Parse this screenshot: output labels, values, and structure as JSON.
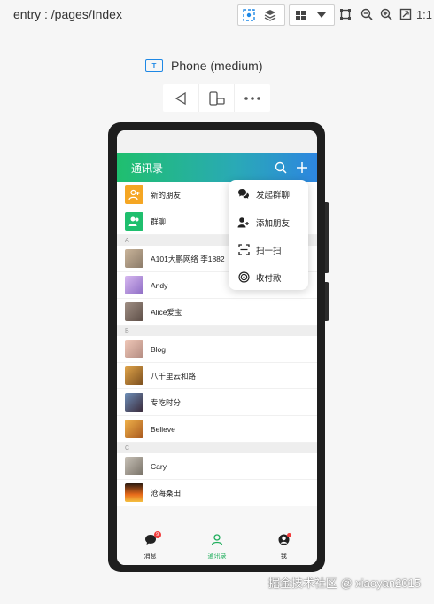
{
  "toolbar": {
    "entry": "entry : /pages/Index",
    "scale_label": "1:1",
    "icons": [
      "inspect-icon",
      "layers-icon",
      "grid-icon",
      "dropdown-icon",
      "crop-icon",
      "zoom-out-icon",
      "zoom-in-icon",
      "fit-icon"
    ]
  },
  "device": {
    "name": "Phone (medium)",
    "actions": [
      "back-icon",
      "rotate-icon",
      "more-icon"
    ]
  },
  "app": {
    "title": "通讯录",
    "accent": "#1fbf6e",
    "contacts_top": [
      {
        "label": "新的朋友",
        "color": "#f5a623"
      },
      {
        "label": "群聊",
        "color": "#1fbf6e"
      }
    ],
    "sections": [
      {
        "letter": "A",
        "items": [
          "A101大鹏网络 李1882",
          "Andy",
          "Alice爱宝"
        ]
      },
      {
        "letter": "B",
        "items": [
          "Blog",
          "八千里云和路",
          "专吃时分",
          "Believe"
        ]
      },
      {
        "letter": "C",
        "items": [
          "Cary",
          "沧海桑田"
        ]
      }
    ],
    "tabs": [
      {
        "label": "消息",
        "badge": "9"
      },
      {
        "label": "通讯录"
      },
      {
        "label": "我"
      }
    ]
  },
  "popup": {
    "items": [
      "发起群聊",
      "添加朋友",
      "扫一扫",
      "收付款"
    ]
  },
  "watermark": "掘金技术社区 @ xiaoyan2015"
}
